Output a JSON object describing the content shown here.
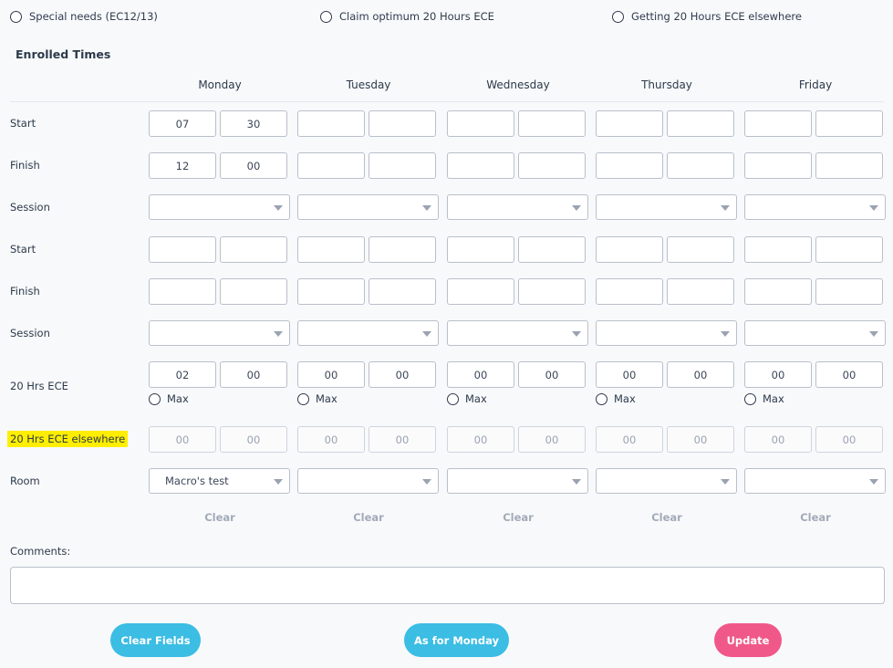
{
  "options": {
    "special_needs": "Special needs (EC12/13)",
    "claim_optimum": "Claim optimum 20 Hours ECE",
    "elsewhere": "Getting 20 Hours ECE elsewhere"
  },
  "section_title": "Enrolled Times",
  "days": [
    "Monday",
    "Tuesday",
    "Wednesday",
    "Thursday",
    "Friday"
  ],
  "labels": {
    "start": "Start",
    "finish": "Finish",
    "session": "Session",
    "ece": "20 Hrs ECE",
    "ece_elsewhere": "20 Hrs ECE elsewhere",
    "room": "Room"
  },
  "max_label": "Max",
  "values": {
    "start1": [
      [
        "07",
        "30"
      ],
      [
        "",
        ""
      ],
      [
        "",
        ""
      ],
      [
        "",
        ""
      ],
      [
        "",
        ""
      ]
    ],
    "finish1": [
      [
        "12",
        "00"
      ],
      [
        "",
        ""
      ],
      [
        "",
        ""
      ],
      [
        "",
        ""
      ],
      [
        "",
        ""
      ]
    ],
    "session1": [
      "",
      "",
      "",
      "",
      ""
    ],
    "start2": [
      [
        "",
        ""
      ],
      [
        "",
        ""
      ],
      [
        "",
        ""
      ],
      [
        "",
        ""
      ],
      [
        "",
        ""
      ]
    ],
    "finish2": [
      [
        "",
        ""
      ],
      [
        "",
        ""
      ],
      [
        "",
        ""
      ],
      [
        "",
        ""
      ],
      [
        "",
        ""
      ]
    ],
    "session2": [
      "",
      "",
      "",
      "",
      ""
    ],
    "ece": [
      [
        "02",
        "00"
      ],
      [
        "00",
        "00"
      ],
      [
        "00",
        "00"
      ],
      [
        "00",
        "00"
      ],
      [
        "00",
        "00"
      ]
    ],
    "ece_elsewhere": [
      [
        "00",
        "00"
      ],
      [
        "00",
        "00"
      ],
      [
        "00",
        "00"
      ],
      [
        "00",
        "00"
      ],
      [
        "00",
        "00"
      ]
    ],
    "room": [
      "Macro's test",
      "",
      "",
      "",
      ""
    ]
  },
  "clear_label": "Clear",
  "comments_label": "Comments:",
  "comments_value": "",
  "buttons": {
    "clear_fields": "Clear Fields",
    "as_for_monday": "As for Monday",
    "update": "Update"
  },
  "colors": {
    "blue": "#3bbde4",
    "pink": "#f0588a",
    "highlight": "#ffee00"
  }
}
